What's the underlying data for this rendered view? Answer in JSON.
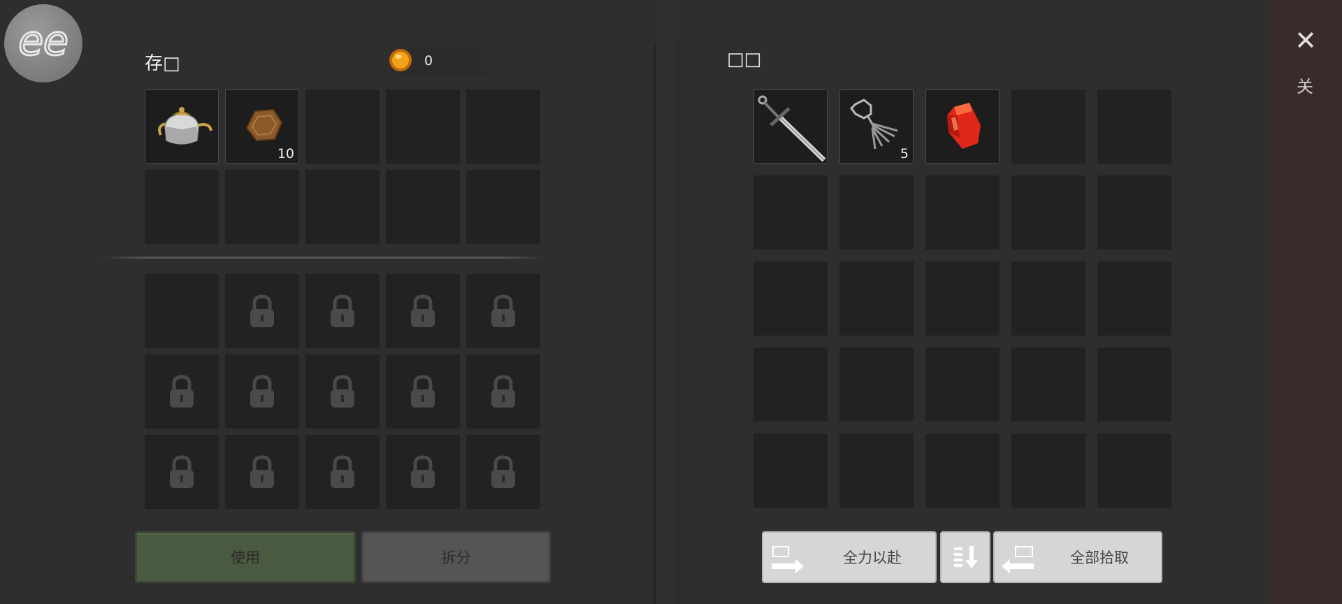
{
  "avatar": {
    "text": "ee"
  },
  "storage": {
    "title": "存□",
    "coins": "0",
    "slots": [
      {
        "item": "teapot",
        "qty": ""
      },
      {
        "item": "wood-plank",
        "qty": "10"
      }
    ],
    "locked_rows": 3
  },
  "loot": {
    "title": "□□",
    "slots": [
      {
        "item": "sword",
        "qty": ""
      },
      {
        "item": "claw-hook",
        "qty": "5"
      },
      {
        "item": "red-gem",
        "qty": ""
      }
    ]
  },
  "buttons": {
    "use": "使用",
    "split": "拆分",
    "all_in": "全力以赴",
    "pick_all": "全部拾取"
  },
  "side": {
    "close": "✕",
    "label": "关"
  },
  "icons": {
    "coin": "coin-icon",
    "lock": "lock-icon",
    "sort": "sort-icon",
    "transfer": "transfer-icon",
    "close": "close-icon"
  },
  "colors": {
    "use_button": "#4a5a40",
    "side_strip": "#3b2a2a",
    "coin": "#f0a020"
  }
}
